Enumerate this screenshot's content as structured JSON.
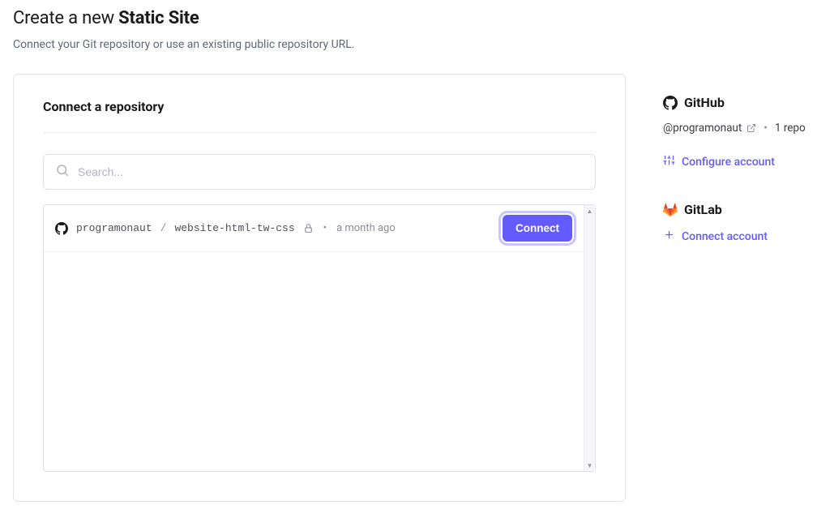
{
  "header": {
    "title_prefix": "Create a new ",
    "title_strong": "Static Site",
    "subtitle": "Connect your Git repository or use an existing public repository URL."
  },
  "card": {
    "title": "Connect a repository",
    "search_placeholder": "Search...",
    "repos": [
      {
        "owner": "programonaut",
        "name": "website-html-tw-css",
        "updated": "a month ago",
        "connect_label": "Connect"
      }
    ]
  },
  "side": {
    "github": {
      "label": "GitHub",
      "handle": "@programonaut",
      "repo_count": "1 repo",
      "configure_label": "Configure account"
    },
    "gitlab": {
      "label": "GitLab",
      "connect_label": "Connect account"
    }
  }
}
